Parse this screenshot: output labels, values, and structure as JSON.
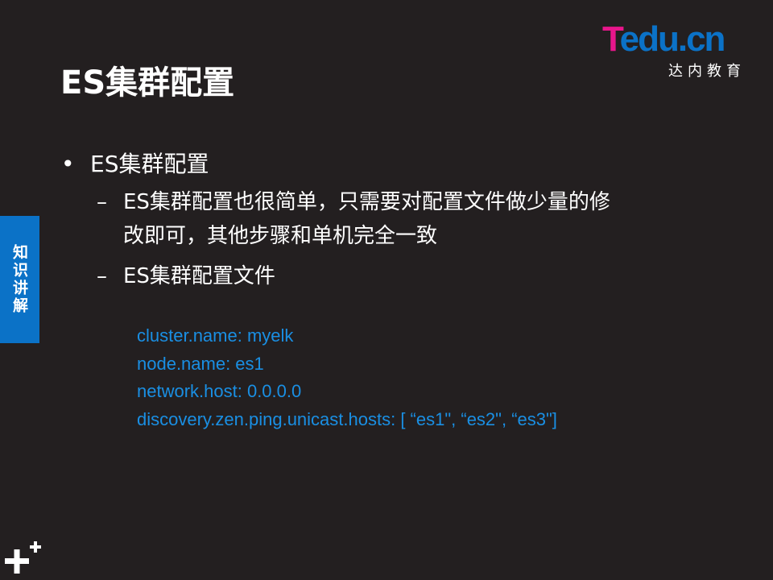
{
  "slide": {
    "title": "ES集群配置",
    "logo_brand": "Tedu.cn",
    "logo_brand_first": "T",
    "logo_brand_rest": "edu.cn",
    "logo_subtitle": "达内教育",
    "side_tab": "知识讲解",
    "bullet_marker": "•",
    "bullet_text": "ES集群配置",
    "dash_marker": "–",
    "sub_items": [
      {
        "line1": "ES集群配置也很简单，只需要对配置文件做少量的修",
        "line2": "改即可，其他步骤和单机完全一致"
      },
      {
        "line1": "ES集群配置文件"
      }
    ],
    "config_lines": [
      "cluster.name: myelk",
      "node.name: es1",
      "network.host: 0.0.0.0",
      "discovery.zen.ping.unicast.hosts: [ “es1\", “es2\", “es3\"]"
    ]
  },
  "colors": {
    "background": "#231f20",
    "accent_blue": "#0b72c7",
    "code_blue": "#1a8fe3",
    "logo_pink": "#e8168b"
  },
  "icons": {
    "corner_logo": "plus-plus-icon"
  }
}
